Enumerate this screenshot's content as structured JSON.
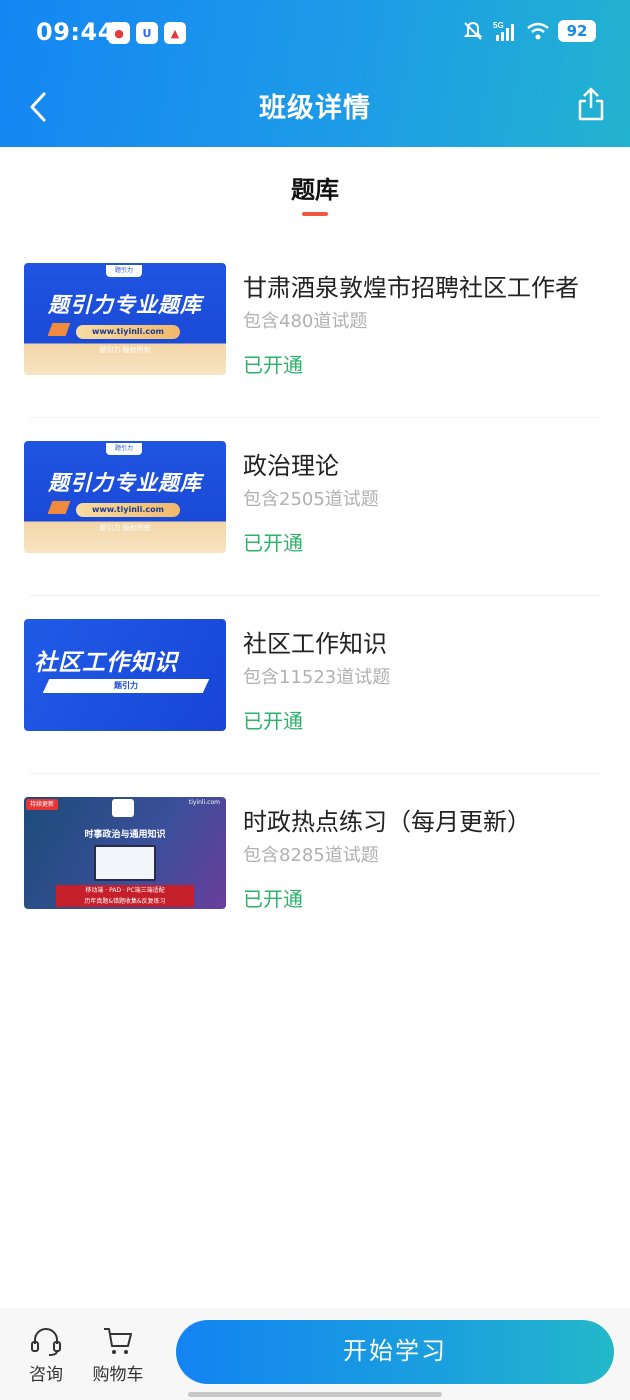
{
  "status_bar": {
    "time": "09:44",
    "network": "5G",
    "battery": "92"
  },
  "header": {
    "title": "班级详情"
  },
  "tab": {
    "label": "题库"
  },
  "items": [
    {
      "title": "甘肃酒泉敦煌市招聘社区工作者",
      "count": "包含480道试题",
      "status": "已开通",
      "thumb": {
        "logo": "题引力",
        "main": "题引力专业题库",
        "url": "www.tiyinli.com",
        "copy": "题引力 版权所有"
      }
    },
    {
      "title": "政治理论",
      "count": "包含2505道试题",
      "status": "已开通",
      "thumb": {
        "logo": "题引力",
        "main": "题引力专业题库",
        "url": "www.tiyinli.com",
        "copy": "题引力 版权所有"
      }
    },
    {
      "title": "社区工作知识",
      "count": "包含11523道试题",
      "status": "已开通",
      "thumb": {
        "main": "社区工作知识",
        "sub": "题引力"
      }
    },
    {
      "title": "时政热点练习（每月更新）",
      "count": "包含8285道试题",
      "status": "已开通",
      "thumb": {
        "tag": "持续更新",
        "site": "tiyinli.com",
        "head": "时事政治与通用知识",
        "banner1": "移动端 · PAD · PC端三端适配",
        "banner2": "历年真题&错题收集&反复练习"
      }
    }
  ],
  "bottom_bar": {
    "consult_label": "咨询",
    "cart_label": "购物车",
    "start_label": "开始学习"
  },
  "colors": {
    "header_start": "#1486f3",
    "header_end": "#22b3cf",
    "accent_underline": "#f05a3c",
    "status_green": "#2bb36a"
  }
}
